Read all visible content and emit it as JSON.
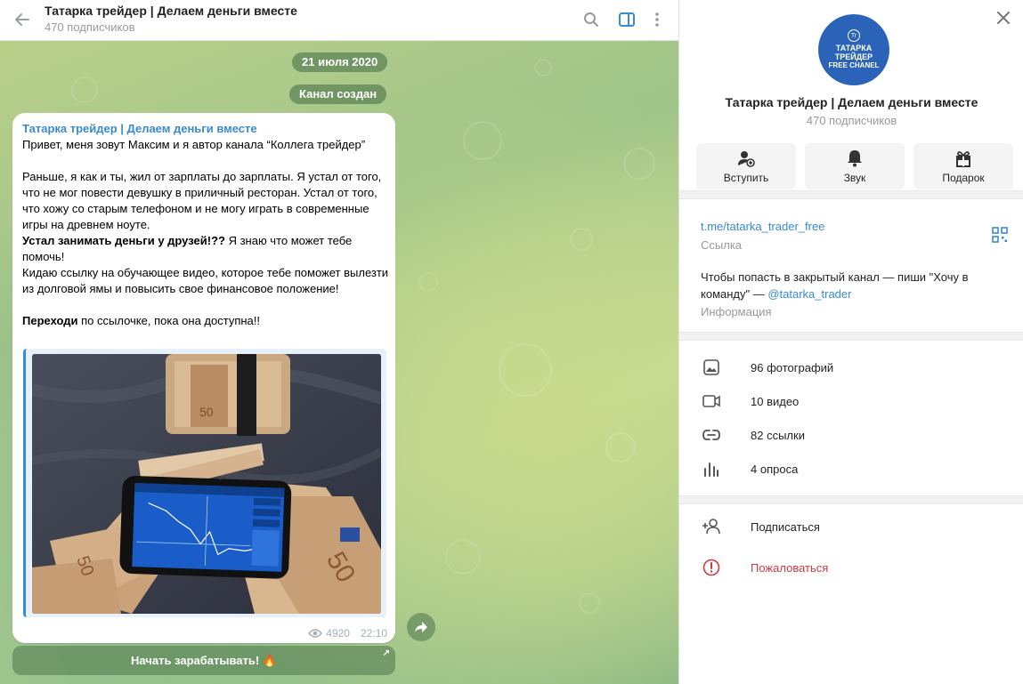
{
  "chat": {
    "title": "Татарка трейдер | Делаем деньги вместе",
    "subscribers": "470 подписчиков",
    "date_pill": "21 июля 2020",
    "service_pill": "Канал создан",
    "message": {
      "author": "Татарка трейдер | Делаем деньги вместе",
      "paragraphs": [
        "Привет, меня зовут Максим и я автор канала “Коллега трейдер”",
        "Раньше, я как и ты, жил от зарплаты до зарплаты. Я устал от того, что не мог повести девушку в приличный ресторан. Устал от того, что хожу со старым телефоном и не могу играть в современные игры на древнем ноуте.",
        "Устал занимать деньги у друзей!??",
        " Я знаю что может тебе помочь!",
        "Кидаю ссылку на обучающее видео, которое тебе поможет вылезти из долговой ямы и повысить свое финансовое положение!",
        "Переходи",
        " по ссылочке, пока она доступна!!"
      ],
      "views": "4920",
      "time": "22:10"
    },
    "cta_button": "Начать зарабатывать! 🔥"
  },
  "panel": {
    "avatar_lines": [
      "ТАТАРКА",
      "ТРЕЙДЕР",
      "FREE CHANEL"
    ],
    "avatar_logo": "Tr",
    "title": "Татарка трейдер | Делаем деньги вместе",
    "subscribers": "470 подписчиков",
    "actions": [
      {
        "label": "Вступить",
        "icon": "add-user-icon"
      },
      {
        "label": "Звук",
        "icon": "bell-icon"
      },
      {
        "label": "Подарок",
        "icon": "gift-icon"
      }
    ],
    "link": {
      "value": "t.me/tatarka_trader_free",
      "label": "Ссылка"
    },
    "info": {
      "text": "Чтобы попасть в закрытый канал — пиши \"Хочу в команду\" — ",
      "mention": "@tatarka_trader",
      "label": "Информация"
    },
    "media_rows": [
      {
        "label": "96 фотографий",
        "icon": "photo-icon"
      },
      {
        "label": "10 видео",
        "icon": "video-icon"
      },
      {
        "label": "82 ссылки",
        "icon": "link-icon"
      },
      {
        "label": "4 опроса",
        "icon": "poll-icon"
      }
    ],
    "subscribe_label": "Подписаться",
    "report_label": "Пожаловаться",
    "colors": {
      "accent": "#3a8ad1",
      "danger": "#d0393e",
      "avatar": "#2a63b8"
    }
  }
}
